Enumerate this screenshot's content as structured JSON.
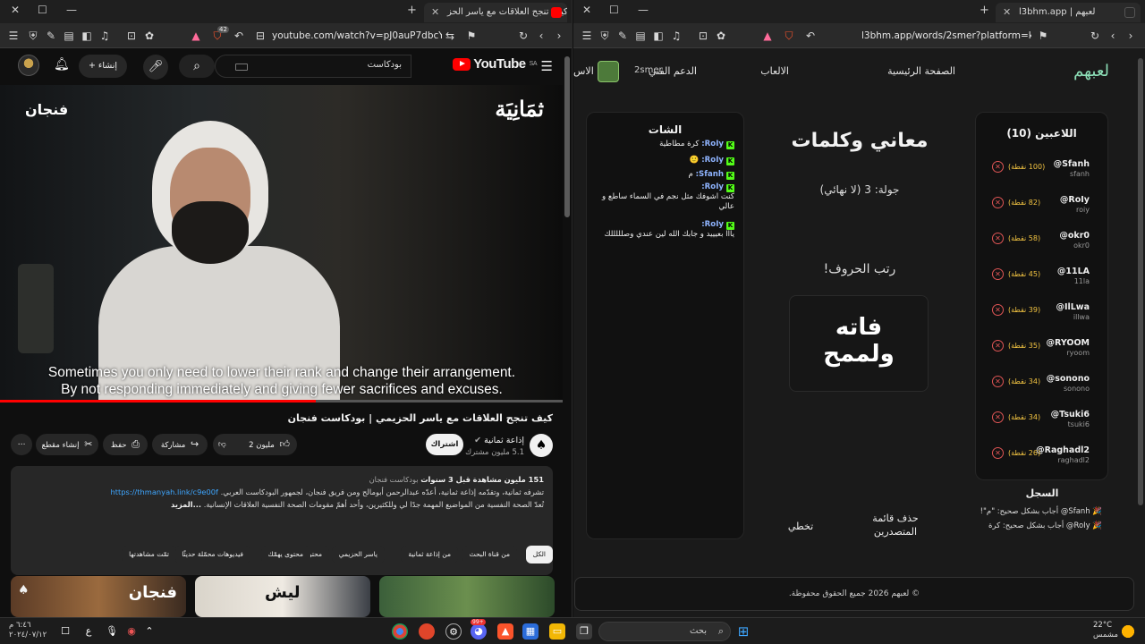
{
  "left_browser": {
    "tab_title": "كيف تنجح العلاقات مع ياسر الحز",
    "url": "youtube.com/watch?v=pJ0auP7dbcY&t=6...",
    "shield_count": "42"
  },
  "right_browser": {
    "tab_title": "l3bhm.app | لعبهم",
    "url": "l3bhm.app/words/2smer?platform=kick"
  },
  "youtube": {
    "logo_text": "YouTube",
    "region": "SA",
    "search_query": "بودكاست",
    "create_label": "إنشاء",
    "video": {
      "brand_right": "ثمَانِيَة",
      "brand_left": "فنجان",
      "subtitle_line1": "Sometimes you only need to lower their rank and change their arrangement.",
      "subtitle_line2": "By not responding immediately and giving fewer sacrifices and excuses.",
      "progress": 0.56
    },
    "title": "كيف تنجح العلاقات مع ياسر الحزيمي | بودكاست فنجان",
    "channel_name": "إذاعة ثمانية",
    "channel_subs": "5.1 مليون مشترك",
    "subscribe_label": "اشتراك",
    "likes_label": "2 مليون",
    "share_label": "مشاركة",
    "save_label": "حفظ",
    "clip_label": "إنشاء مقطع",
    "description": {
      "views": "151 مليون مشاهدة",
      "age": "قبل 3 سنوات",
      "tag": "بودكاست فنجان",
      "line1_prefix": "تشرفه ثمانية، وتقدّمه إذاعة ثمانية، أعدّه عبدالرحمن أبومالح ومن فريق فنجان، لجمهور البودكاست العربي.",
      "link": "https://thmanyah.link/c9e00f",
      "line2": "تُعدّ الصحة النفسية من المواضيع المهمة جدًا لي وللكثيرين، وأحد أهمّ مقومات الصحة النفسية العلاقات الإنسانية.",
      "more": "...المزيد"
    },
    "chips": [
      "الكل",
      "من قناة البحث",
      "من إذاعة ثمانية",
      "ياسر الحزيمي",
      "محتوى مشابه",
      "محتوى يهمّك",
      "فيديوهات محمّلة حديثًا",
      "تمّت مشاهدتها"
    ],
    "thumb_texts": [
      "فنجان",
      "ليش",
      ""
    ]
  },
  "l3bhm": {
    "logo": "لعبهم",
    "nav": {
      "home": "الصفحة الرئيسية",
      "games": "الالعاب",
      "support": "الدعم الفني",
      "extra": "الاس",
      "user": "2smer"
    },
    "players_title": "اللاعبين (10)",
    "players": [
      {
        "name": "@Sfanh",
        "user": "sfanh",
        "points": "(100 نقطة)"
      },
      {
        "name": "@RoIy",
        "user": "roiy",
        "points": "(82 نقطة)"
      },
      {
        "name": "@okr0",
        "user": "okr0",
        "points": "(58 نقطة)"
      },
      {
        "name": "@11LA",
        "user": "11la",
        "points": "(45 نقطة)"
      },
      {
        "name": "@IlLwa",
        "user": "illwa",
        "points": "(39 نقطة)"
      },
      {
        "name": "@RYOOM",
        "user": "ryoom",
        "points": "(35 نقطة)"
      },
      {
        "name": "@sonono",
        "user": "sonono",
        "points": "(34 نقطة)"
      },
      {
        "name": "@Tsuki6",
        "user": "tsuki6",
        "points": "(34 نقطة)"
      },
      {
        "name": "@Raghadl2",
        "user": "raghadl2",
        "points": "(26 نقطة)"
      }
    ],
    "game_title": "معاني وكلمات",
    "round": "جولة: 3 (لا نهائي)",
    "prompt": "رتب الحروف!",
    "scrambled_line1": "فاته",
    "scrambled_line2": "ولممح",
    "chat_title": "الشات",
    "chat": [
      {
        "user": "RoIy:",
        "text": "كرة مطاطية"
      },
      {
        "user": "RoIy:",
        "text": "🙂"
      },
      {
        "user": "Sfanh:",
        "text": "م"
      },
      {
        "user": "RoIy:",
        "text": "كنت اشوفك مثل نجم في السماء ساطع و عالي"
      },
      {
        "user": "RoIy:",
        "text": "يااا بعيييد و جابك الله لين عندي وصلللللك"
      }
    ],
    "clear_board": "حذف قائمة المتصدرين",
    "skip": "تخطي",
    "log_title": "السجل",
    "log": [
      "🎉 Sfanh@ أجاب بشكل صحيح: \"م\"!",
      "🎉 RoIy@ أجاب بشكل صحيح: كرة"
    ],
    "footer": "© لعبهم 2026 جميع الحقوق محفوظة."
  },
  "taskbar": {
    "search_placeholder": "بحث",
    "weather_temp": "22°C",
    "weather_desc": "مشمس",
    "time": "٦:٤٦ م",
    "date": "٢٠٢٤/٠٧/١٢",
    "lang": "ع",
    "discord_badge": "99+"
  },
  "colors": {
    "yt_red": "#ff0000",
    "kick_green": "#53fc18",
    "points_gold": "#f4c542",
    "kick_red": "#e05555",
    "l3_logo": "#8de0b8"
  }
}
